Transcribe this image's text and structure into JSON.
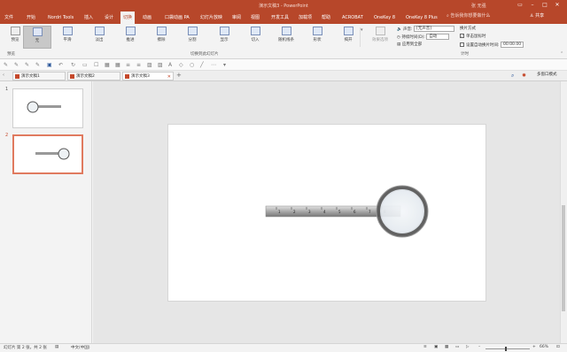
{
  "title": "演示文稿3 - PowerPoint",
  "user": "张 无强",
  "menu": {
    "items": [
      "文件",
      "开始",
      "Nordri Tools",
      "插入",
      "设计",
      "切换",
      "动画",
      "口袋动画 PA",
      "幻灯片放映",
      "审阅",
      "视图",
      "开发工具",
      "加载项",
      "帮助",
      "ACROBAT",
      "OneKey 8",
      "OneKey 8 Plus"
    ],
    "active_index": 5,
    "tellme": "告诉我你想要做什么",
    "share": "共享"
  },
  "ribbon": {
    "preview_label": "预览",
    "transitions": [
      "无",
      "平滑",
      "淡出",
      "推进",
      "擦除",
      "分割",
      "显示",
      "切入",
      "随机线条",
      "形状",
      "揭开"
    ],
    "effect_options": "效果选项",
    "group_preview": "预览",
    "group_transitions": "切换到此幻灯片",
    "sound_label": "声音:",
    "sound_value": "[无声音]",
    "duration_label": "持续时间(D):",
    "duration_value": "自动",
    "apply_all": "应用到全部",
    "advance_label": "换片方式",
    "on_click": "单击鼠标时",
    "after_label": "设置自动换片时间:",
    "after_value": "00:00.00",
    "group_timing": "计时"
  },
  "tabs": [
    "演示文稿1",
    "演示文稿2",
    "演示文稿3"
  ],
  "multi_window": "多窗口模式",
  "slides": [
    {
      "number": "1"
    },
    {
      "number": "2"
    }
  ],
  "ruler_ticks": [
    "1",
    "2",
    "3",
    "4",
    "5",
    "6",
    "7",
    "8"
  ],
  "status": {
    "slide_info": "幻灯片 第 2 张，共 2 张",
    "language": "中文(中国)",
    "zoom": "66%"
  }
}
